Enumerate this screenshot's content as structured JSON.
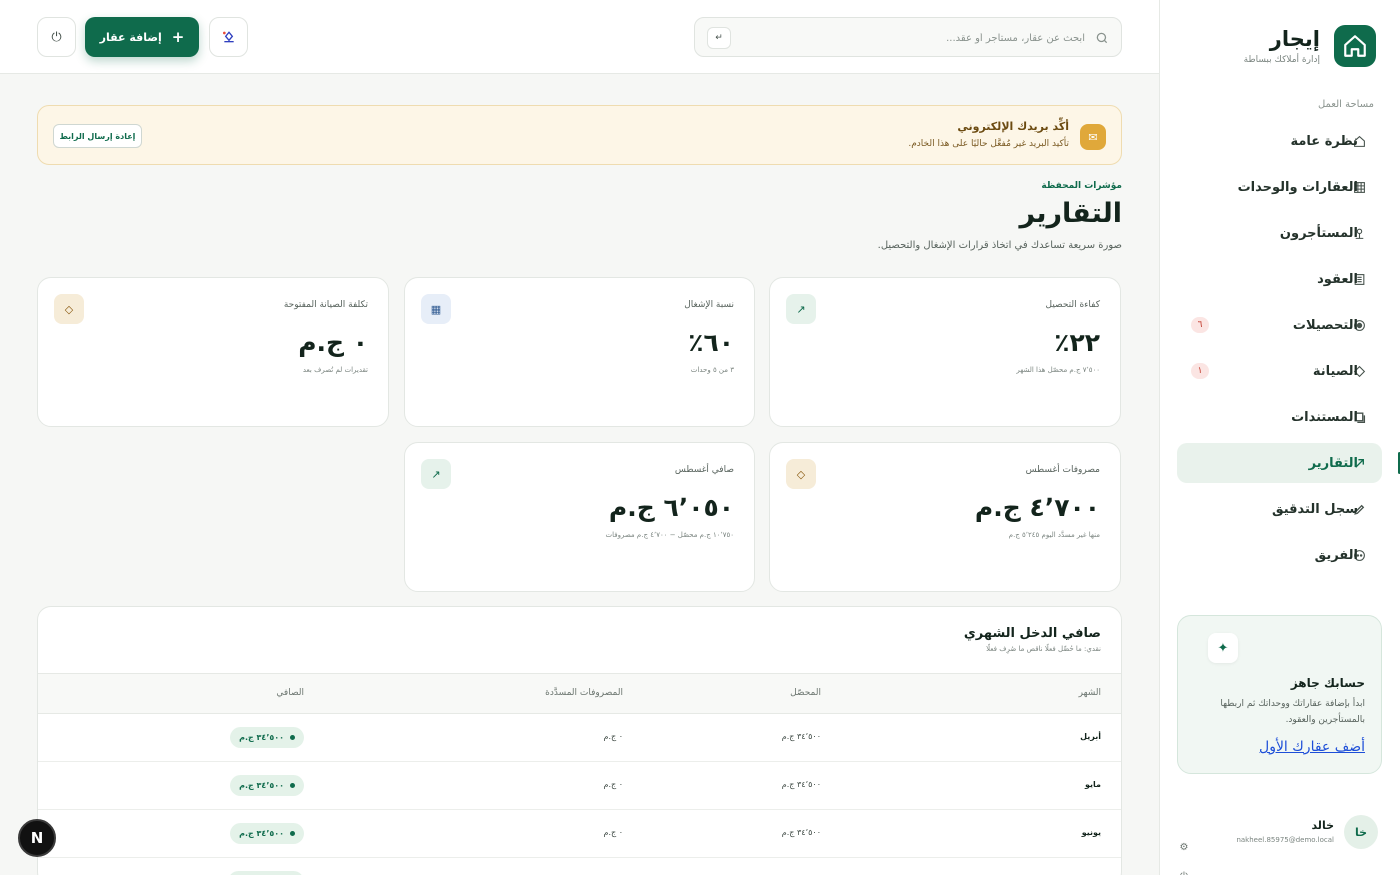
{
  "brand": {
    "name": "إيجار",
    "tagline": "إدارة أملاكك ببساطة"
  },
  "sidebar": {
    "section_label": "مساحة العمل",
    "items": [
      {
        "label": "نظرة عامة",
        "icon": "home-icon",
        "badge": ""
      },
      {
        "label": "العقارات والوحدات",
        "icon": "grid-icon",
        "badge": ""
      },
      {
        "label": "المستأجرون",
        "icon": "person-icon",
        "badge": ""
      },
      {
        "label": "العقود",
        "icon": "document-icon",
        "badge": ""
      },
      {
        "label": "التحصيلات",
        "icon": "target-icon",
        "badge": "٦"
      },
      {
        "label": "الصيانة",
        "icon": "diamond-icon",
        "badge": "١"
      },
      {
        "label": "المستندات",
        "icon": "folder-icon",
        "badge": ""
      },
      {
        "label": "التقارير",
        "icon": "trend-icon",
        "badge": "",
        "active": true
      },
      {
        "label": "سجل التدقيق",
        "icon": "pencil-icon",
        "badge": ""
      },
      {
        "label": "الفريق",
        "icon": "team-icon",
        "badge": ""
      }
    ]
  },
  "promo": {
    "title": "حسابك جاهز",
    "text": "ابدأ بإضافة عقاراتك ووحداتك ثم اربطها بالمستأجرين والعقود.",
    "link": "أضف عقارك الأول"
  },
  "user": {
    "initials": "خا",
    "name": "خالد",
    "email": "nakheel.85975@demo.local"
  },
  "topbar": {
    "search_placeholder": "ابحث عن عقار، مستأجر أو عقد...",
    "search_shortcut": "↵",
    "add_button": "إضافة عقار",
    "add_icon": "+"
  },
  "alert": {
    "title": "أكِّد بريدك الإلكتروني",
    "text": "تأكيد البريد غير مُفعَّل حاليًا على هذا الخادم.",
    "button": "إعادة إرسال الرابط"
  },
  "page": {
    "eyebrow": "مؤشرات المحفظة",
    "title": "التقارير",
    "subtitle": "صورة سريعة تساعدك في اتخاذ قرارات الإشغال والتحصيل."
  },
  "kpis": [
    {
      "label": "كفاءة التحصيل",
      "value": "٢٢٪",
      "note": "٧٬٥٠٠ ج.م محصّل هذا الشهر",
      "icon": "trend-icon",
      "tone": "green"
    },
    {
      "label": "نسبة الإشغال",
      "value": "٦٠٪",
      "note": "٣ من ٥ وحدات",
      "icon": "grid-icon",
      "tone": "blue"
    },
    {
      "label": "تكلفة الصيانة المفتوحة",
      "value": "٠ ج.م",
      "note": "تقديرات لم تُصرف بعد",
      "icon": "diamond-icon",
      "tone": "amber"
    },
    {
      "label": "مصروفات أغسطس",
      "value": "٤٬٧٠٠ ج.م",
      "note": "منها غير مسدَّد اليوم ٥٬٢٤٥ ج.م",
      "icon": "diamond-icon",
      "tone": "amber"
    },
    {
      "label": "صافي أغسطس",
      "value": "٦٬٠٥٠ ج.م",
      "note": "١٠٬٧٥٠ ج.م محصّل − ٤٬٧٠٠ ج.م مصروفات",
      "icon": "trend-icon",
      "tone": "green"
    }
  ],
  "table": {
    "title": "صافي الدخل الشهري",
    "subtitle": "نقدي: ما حُصِّل فعلًا ناقص ما صُرِف فعلًا",
    "columns": {
      "month": "الشهر",
      "collected": "المحصّل",
      "expenses": "المصروفات المسدَّدة",
      "net": "الصافي"
    },
    "rows": [
      {
        "month": "أبريل",
        "collected": "٣٤٬٥٠٠ ج.م",
        "expenses": "٠ ج.م",
        "net": "٣٤٬٥٠٠ ج.م"
      },
      {
        "month": "مايو",
        "collected": "٣٤٬٥٠٠ ج.م",
        "expenses": "٠ ج.م",
        "net": "٣٤٬٥٠٠ ج.م"
      },
      {
        "month": "يونيو",
        "collected": "٣٤٬٥٠٠ ج.م",
        "expenses": "٠ ج.م",
        "net": "٣٤٬٥٠٠ ج.م"
      },
      {
        "month": "",
        "collected": "",
        "expenses": "",
        "net": ""
      }
    ]
  },
  "dev_badge": "N",
  "colors": {
    "primary": "#0f6b4c",
    "alert_bg": "#fdf6e7",
    "badge_red": "#c0392b"
  }
}
